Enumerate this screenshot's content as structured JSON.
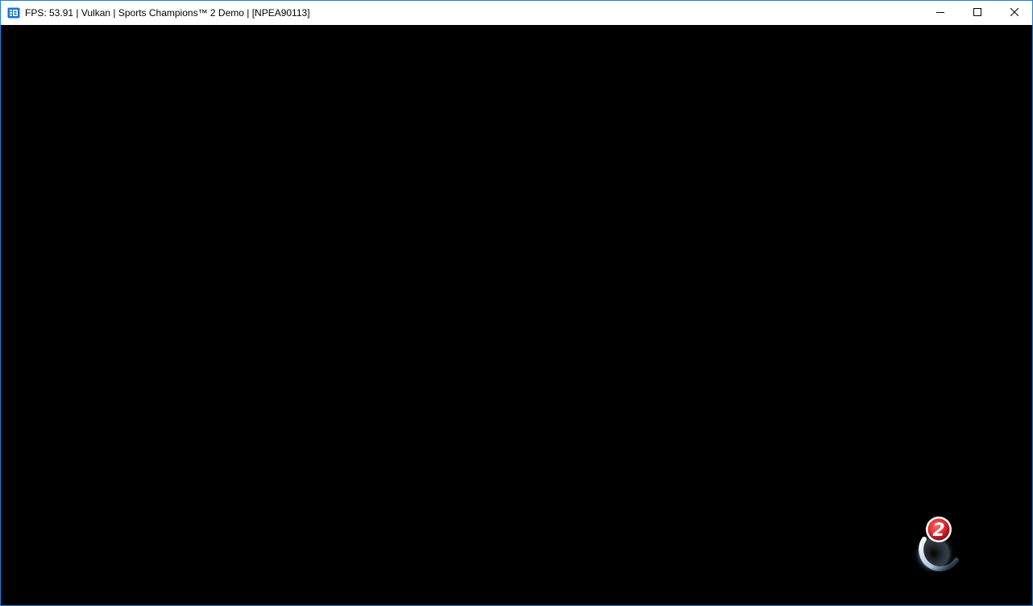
{
  "window": {
    "title": "FPS: 53.91 | Vulkan | Sports Champions™ 2 Demo | [NPEA90113]",
    "app_icon": "rpcs3-icon",
    "controls": {
      "minimize_icon": "minimize-icon",
      "maximize_icon": "maximize-icon",
      "close_icon": "close-icon"
    }
  },
  "game_screen": {
    "background_color": "#000000",
    "loading_indicator": {
      "icon": "sports-champions-2-loading-icon",
      "badge_text": "2",
      "badge_color": "#d8262e",
      "ring_color": "#a9c6e0"
    }
  },
  "colors": {
    "window_border": "#1883d7",
    "titlebar_bg": "#ffffff",
    "app_icon_blue": "#1a73d9"
  }
}
